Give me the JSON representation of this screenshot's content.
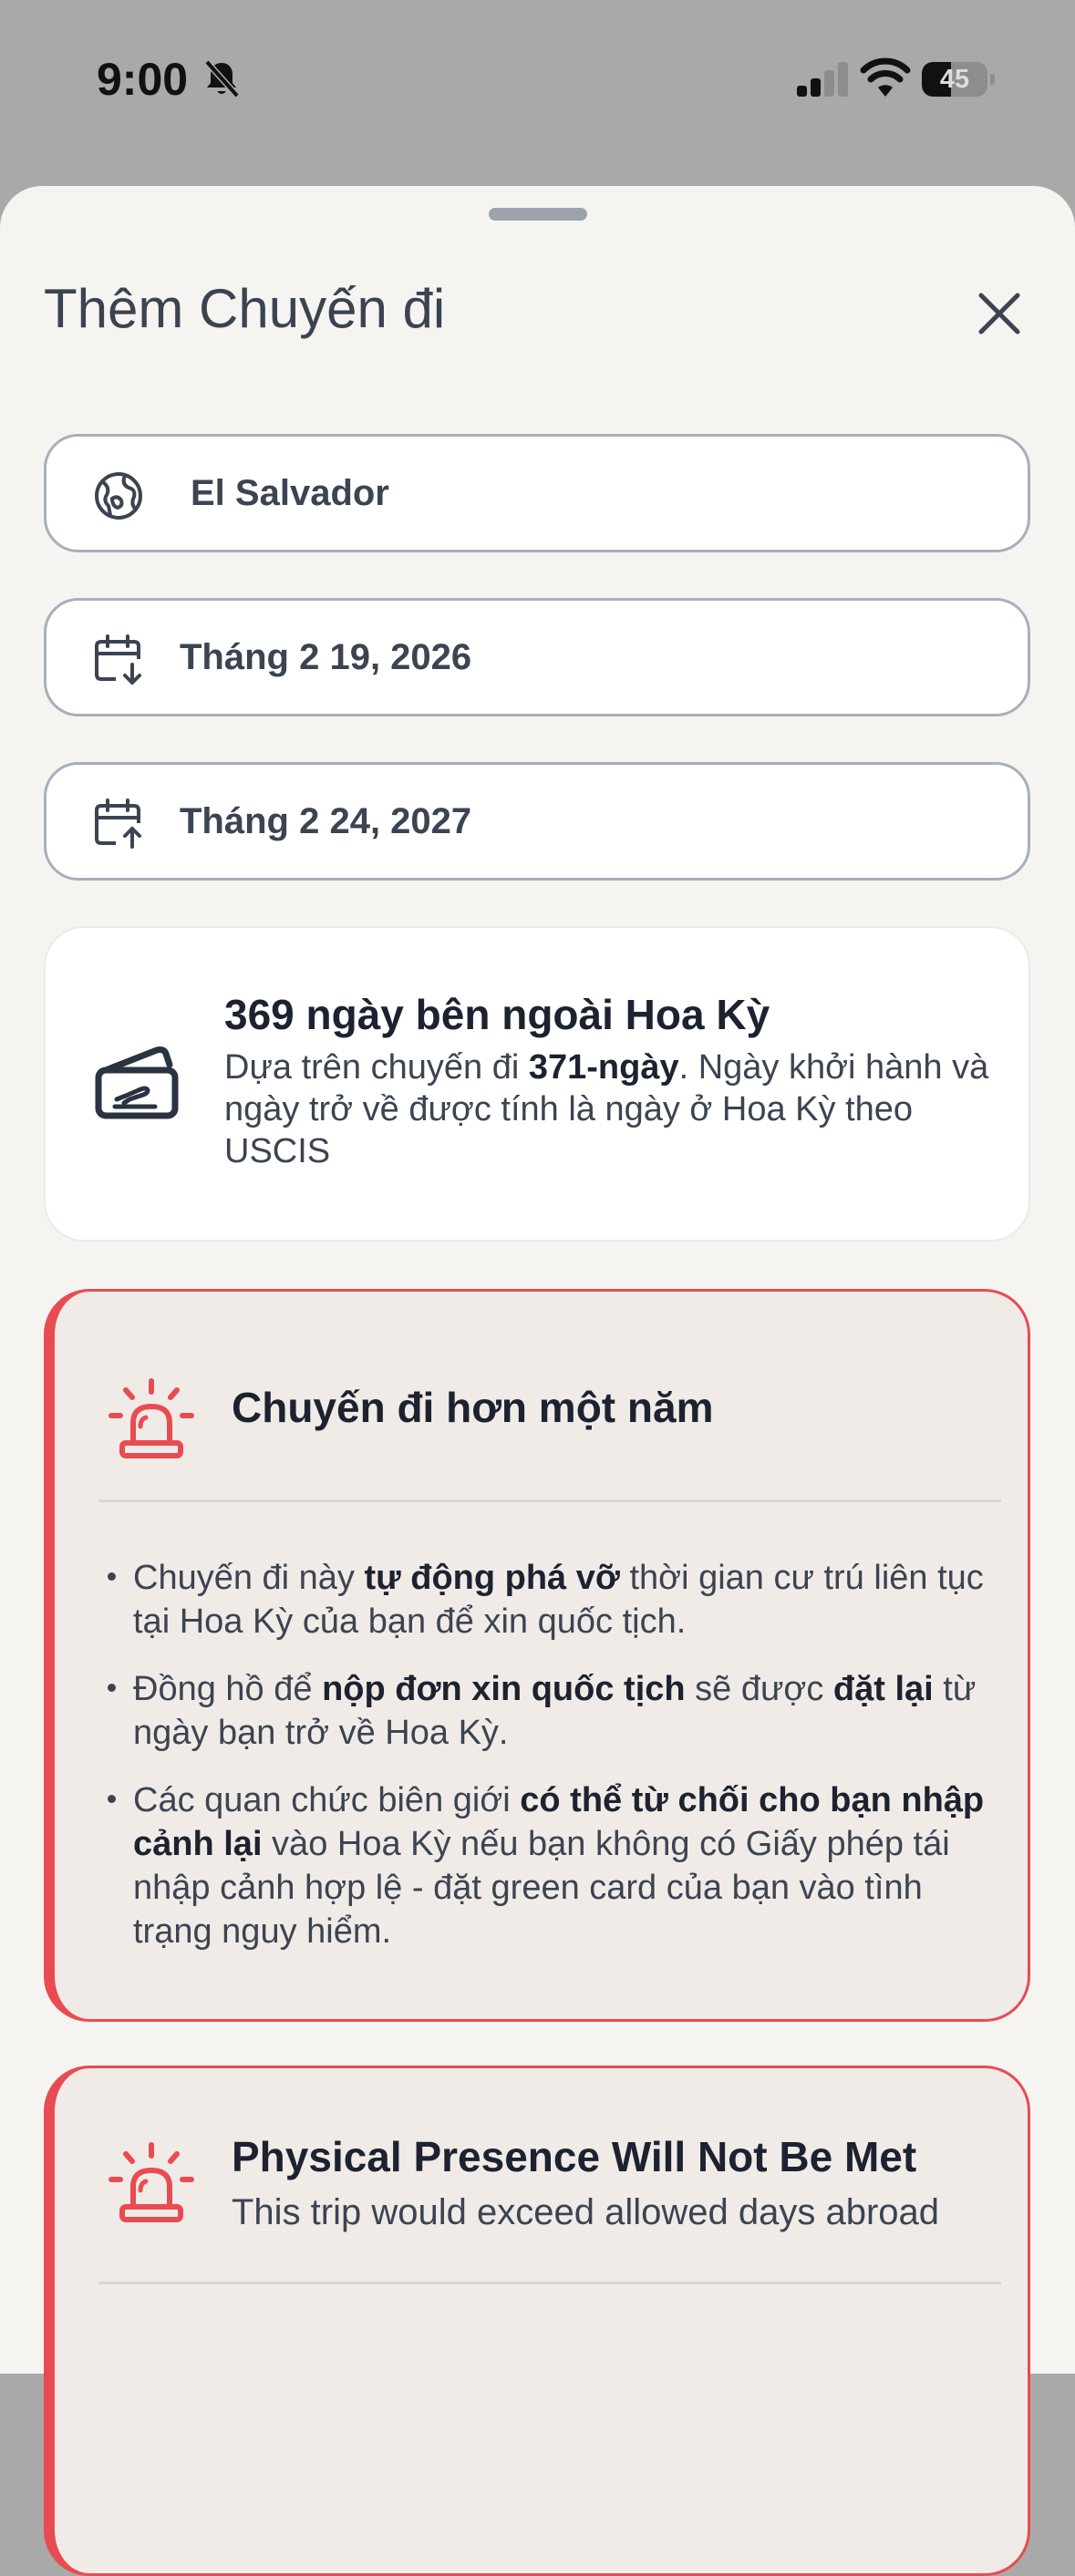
{
  "status_bar": {
    "time": "9:00",
    "battery": "45",
    "battery_level": 0.45,
    "icons": [
      "bell-muted-icon",
      "cellular-signal-icon",
      "wifi-icon",
      "battery-icon"
    ]
  },
  "sheet": {
    "title": "Thêm Chuyến đi",
    "close_icon": "close-icon"
  },
  "fields": {
    "country": {
      "value": "El Salvador",
      "icon": "globe-icon"
    },
    "departure_date": {
      "value": "Tháng 2 19, 2026",
      "icon": "calendar-departure-icon"
    },
    "return_date": {
      "value": "Tháng 2 24, 2027",
      "icon": "calendar-return-icon"
    }
  },
  "summary": {
    "icon": "ticket-icon",
    "title": "369 ngày bên ngoài Hoa Kỳ",
    "text_prefix": "Dựa trên chuyến đi ",
    "text_bold": "371-ngày",
    "text_suffix": ". Ngày khởi hành và ngày trở về được tính là ngày ở Hoa Kỳ theo USCIS"
  },
  "alerts": [
    {
      "icon": "alarm-siren-icon",
      "title": "Chuyến đi hơn một năm",
      "bullets": [
        {
          "p1": "Chuyến đi này ",
          "b1": "tự động phá vỡ",
          "p2": " thời gian cư trú liên tục tại Hoa Kỳ của bạn để xin quốc tịch.",
          "b2": "",
          "p3": ""
        },
        {
          "p1": "Đồng hồ để ",
          "b1": "nộp đơn xin quốc tịch",
          "p2": " sẽ được ",
          "b2": "đặt lại",
          "p3": " từ ngày bạn trở về Hoa Kỳ."
        },
        {
          "p1": "Các quan chức biên giới ",
          "b1": "có thể từ chối cho bạn nhập cảnh lại",
          "p2": " vào Hoa Kỳ nếu bạn không có Giấy phép tái nhập cảnh hợp lệ - đặt green card của bạn vào tình trạng nguy hiểm.",
          "b2": "",
          "p3": ""
        }
      ]
    },
    {
      "icon": "alarm-siren-icon",
      "title": "Physical Presence Will Not Be Met",
      "subtitle": "This trip would exceed allowed days abroad"
    }
  ],
  "colors": {
    "alert_red": "#e84c52",
    "text_dark": "#1c2230",
    "text_body": "#3c4452",
    "sheet_bg": "#f5f4f1"
  }
}
